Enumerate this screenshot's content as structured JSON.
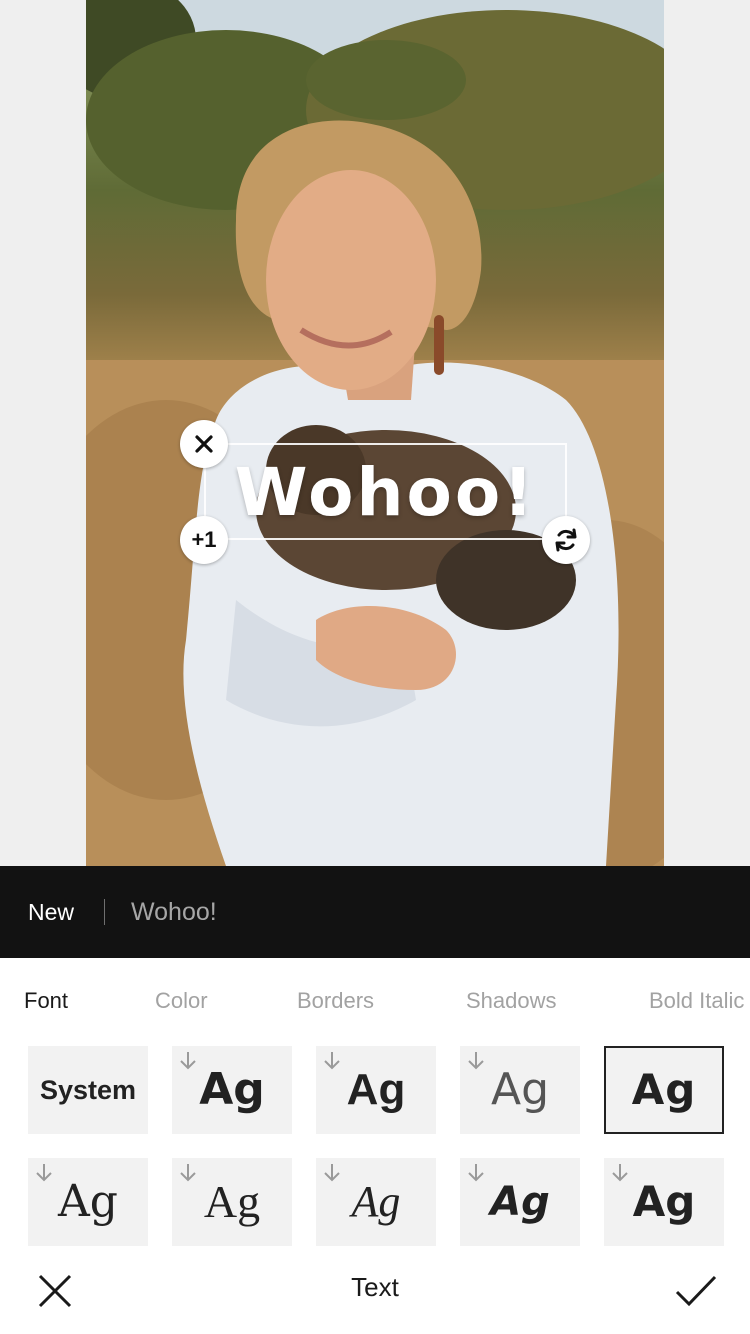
{
  "sticker": {
    "text": "Wohoo!",
    "duplicate_label": "+1"
  },
  "layers": {
    "new_label": "New",
    "current_layer": "Wohoo!"
  },
  "tabs": [
    {
      "label": "Font",
      "active": true
    },
    {
      "label": "Color",
      "active": false
    },
    {
      "label": "Borders",
      "active": false
    },
    {
      "label": "Shadows",
      "active": false
    },
    {
      "label": "Bold Italic",
      "active": false
    }
  ],
  "fonts": [
    {
      "label": "System",
      "downloadable": false,
      "selected": false
    },
    {
      "label": "Ag",
      "downloadable": true,
      "selected": false
    },
    {
      "label": "Ag",
      "downloadable": true,
      "selected": false
    },
    {
      "label": "Ag",
      "downloadable": true,
      "selected": false
    },
    {
      "label": "Ag",
      "downloadable": false,
      "selected": true
    },
    {
      "label": "Ag",
      "downloadable": true,
      "selected": false
    },
    {
      "label": "Ag",
      "downloadable": true,
      "selected": false
    },
    {
      "label": "Ag",
      "downloadable": true,
      "selected": false
    },
    {
      "label": "Ag",
      "downloadable": true,
      "selected": false
    },
    {
      "label": "Ag",
      "downloadable": true,
      "selected": false
    }
  ],
  "toolbar": {
    "title": "Text",
    "cancel_icon": "close-icon",
    "confirm_icon": "checkmark-icon"
  },
  "colors": {
    "layer_bar": "#121212",
    "active_tab": "#1a1a1a",
    "inactive_tab": "#a2a2a2",
    "tile": "#f2f2f2"
  }
}
